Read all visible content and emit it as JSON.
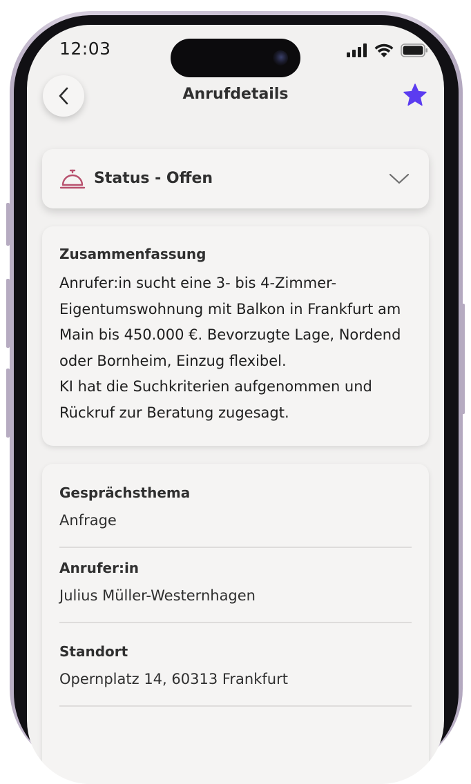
{
  "status_bar": {
    "time": "12:03"
  },
  "header": {
    "title": "Anrufdetails",
    "favorite_color": "#5b3cf0"
  },
  "status": {
    "label": "Status - Offen",
    "icon_color": "#b8516e"
  },
  "summary": {
    "title": "Zusammenfassung",
    "paragraph_1": "Anrufer:in sucht eine 3- bis 4-Zimmer-Eigentumswohnung mit Balkon in Frankfurt am Main bis 450.000 €. Bevorzugte Lage, Nordend oder Bornheim, Einzug flexibel.",
    "paragraph_2": "KI hat die Suchkriterien aufgenommen und Rückruf zur Beratung zugesagt."
  },
  "details": [
    {
      "label": "Gesprächsthema",
      "value": "Anfrage"
    },
    {
      "label": "Anrufer:in",
      "value": "Julius Müller-Westernhagen"
    },
    {
      "label": "Standort",
      "value": "Opernplatz 14, 60313 Frankfurt"
    }
  ]
}
